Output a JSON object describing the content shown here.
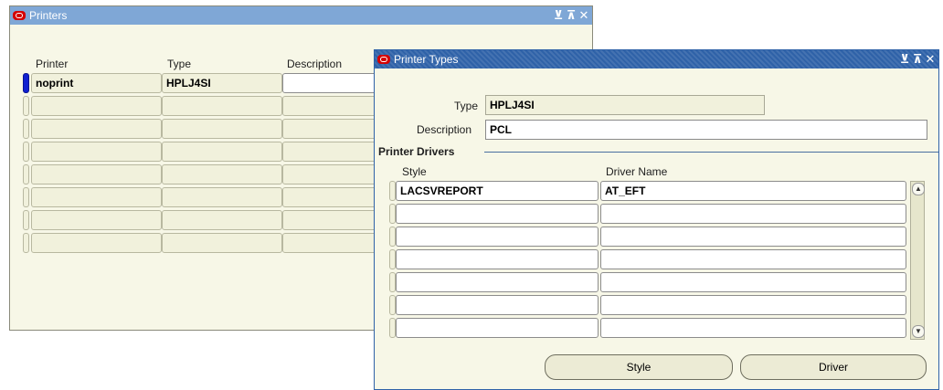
{
  "printers_window": {
    "title": "Printers",
    "columns": {
      "printer": "Printer",
      "type": "Type",
      "description": "Description"
    },
    "rows": [
      {
        "printer": "noprint",
        "type": "HPLJ4SI",
        "description": ""
      },
      {
        "printer": "",
        "type": "",
        "description": ""
      },
      {
        "printer": "",
        "type": "",
        "description": ""
      },
      {
        "printer": "",
        "type": "",
        "description": ""
      },
      {
        "printer": "",
        "type": "",
        "description": ""
      },
      {
        "printer": "",
        "type": "",
        "description": ""
      },
      {
        "printer": "",
        "type": "",
        "description": ""
      },
      {
        "printer": "",
        "type": "",
        "description": ""
      }
    ]
  },
  "printer_types_window": {
    "title": "Printer Types",
    "type_label": "Type",
    "type_value": "HPLJ4SI",
    "description_label": "Description",
    "description_value": "PCL",
    "section_title": "Printer Drivers",
    "columns": {
      "style": "Style",
      "driver_name": "Driver Name"
    },
    "rows": [
      {
        "style": "LACSVREPORT",
        "driver": "AT_EFT"
      },
      {
        "style": "",
        "driver": ""
      },
      {
        "style": "",
        "driver": ""
      },
      {
        "style": "",
        "driver": ""
      },
      {
        "style": "",
        "driver": ""
      },
      {
        "style": "",
        "driver": ""
      },
      {
        "style": "",
        "driver": ""
      }
    ],
    "buttons": {
      "style": "Style",
      "driver": "Driver"
    }
  },
  "icons": {
    "window_icon": "oracle-icon",
    "minimize": "minimize-icon",
    "maximize": "maximize-icon",
    "close": "close-icon"
  },
  "colors": {
    "titlebar_printers": "#7fa7d6",
    "titlebar_types": "#2f62a8",
    "canvas": "#f7f7e7",
    "active_indicator": "#1020d0"
  }
}
